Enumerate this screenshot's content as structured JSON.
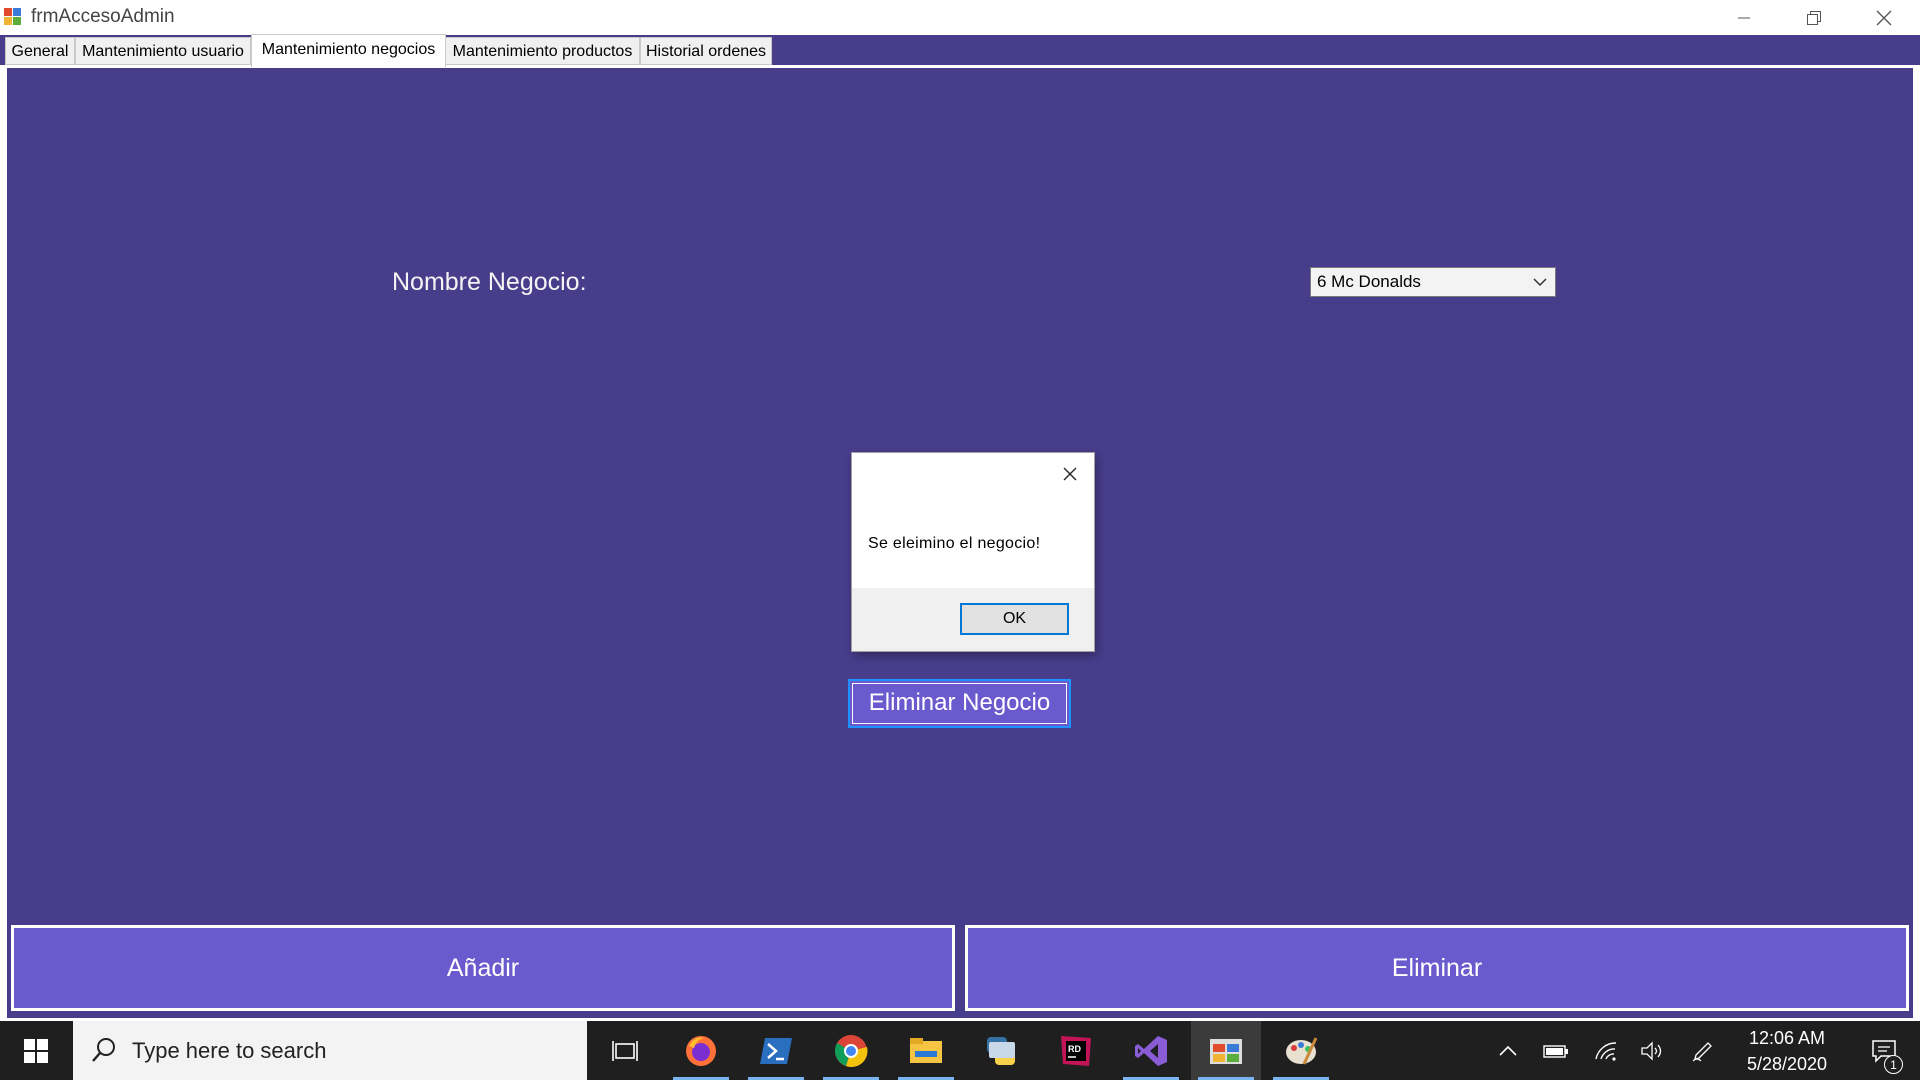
{
  "window": {
    "title": "frmAccesoAdmin"
  },
  "tabs": [
    {
      "label": "General"
    },
    {
      "label": "Mantenimiento usuario"
    },
    {
      "label": "Mantenimiento negocios"
    },
    {
      "label": "Mantenimiento productos"
    },
    {
      "label": "Historial ordenes"
    }
  ],
  "form": {
    "nombre_label": "Nombre Negocio:",
    "negocio_selected": "6 Mc Donalds",
    "eliminar_negocio_label": "Eliminar Negocio",
    "anadir_label": "Añadir",
    "eliminar_label": "Eliminar"
  },
  "dialog": {
    "message": "Se eleimino el negocio!",
    "ok_label": "OK"
  },
  "taskbar": {
    "search_placeholder": "Type here to search",
    "time": "12:06 AM",
    "date": "5/28/2020",
    "notification_count": "1",
    "apps": [
      "task-view-icon",
      "firefox-icon",
      "powershell-icon",
      "chrome-icon",
      "file-explorer-icon",
      "python-icon",
      "rider-icon",
      "visual-studio-icon",
      "winforms-app-icon",
      "paint-icon"
    ]
  },
  "colors": {
    "tabpage_bg": "#483d8b",
    "button_bg": "#6a5acd",
    "focus_border": "#1e90ff",
    "taskbar_bg": "#1f1f1f"
  }
}
